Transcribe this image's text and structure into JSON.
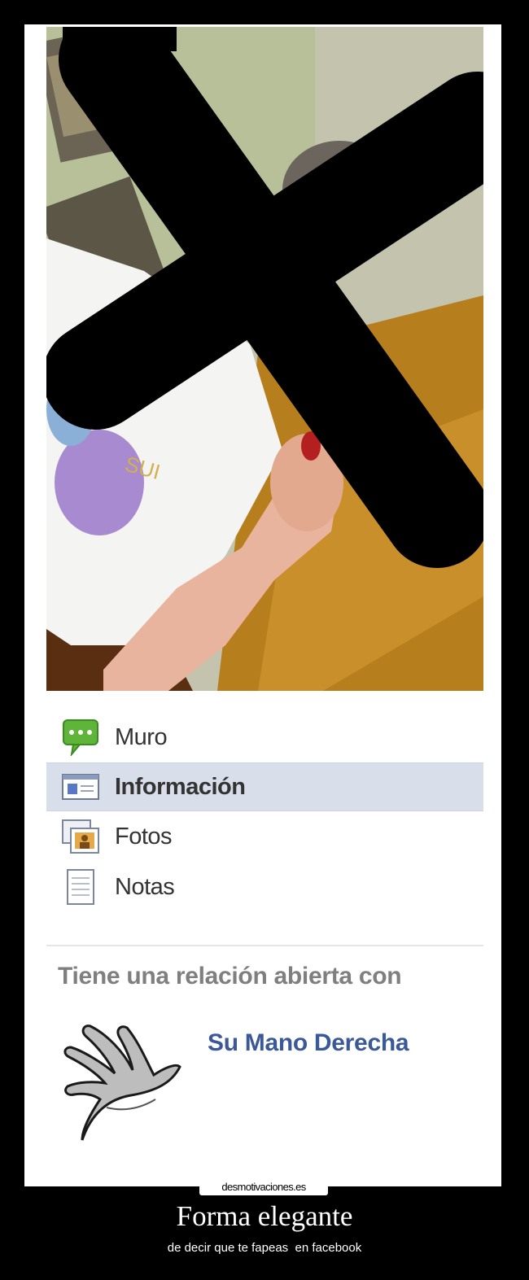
{
  "profile": {
    "photo_alt": "censored profile photo"
  },
  "nav": {
    "items": [
      {
        "label": "Muro",
        "icon": "wall-speech-bubble-icon"
      },
      {
        "label": "Información",
        "icon": "info-card-icon"
      },
      {
        "label": "Fotos",
        "icon": "photos-icon"
      },
      {
        "label": "Notas",
        "icon": "notes-icon"
      }
    ],
    "active_index": 1
  },
  "relationship": {
    "heading": "Tiene una relación abierta con",
    "partner_name": "Su Mano Derecha",
    "avatar_icon": "hand-avatar-icon"
  },
  "watermark": {
    "text": "desmotivaciones.es"
  },
  "caption": {
    "title": "Forma elegante",
    "subtitle": "de decir que te fapeas  en facebook"
  },
  "colors": {
    "link": "#3b5998",
    "active_bg": "#d9dfea",
    "heading_gray": "#7f7f7f"
  }
}
